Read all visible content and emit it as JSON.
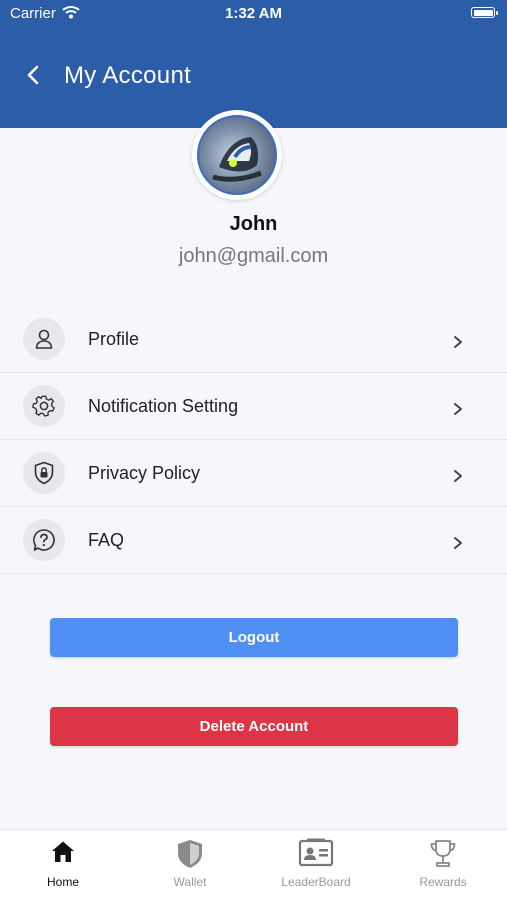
{
  "status_bar": {
    "carrier": "Carrier",
    "time": "1:32 AM"
  },
  "header": {
    "title": "My Account",
    "back_icon": "chevron-left-icon"
  },
  "user": {
    "name": "John",
    "email": "john@gmail.com"
  },
  "menu": [
    {
      "label": "Profile",
      "icon": "person-icon"
    },
    {
      "label": "Notification Setting",
      "icon": "gear-icon"
    },
    {
      "label": "Privacy Policy",
      "icon": "shield-lock-icon"
    },
    {
      "label": "FAQ",
      "icon": "question-bubble-icon"
    }
  ],
  "buttons": {
    "logout": "Logout",
    "delete_account": "Delete Account"
  },
  "tabs": [
    {
      "label": "Home",
      "icon": "home-icon",
      "active": true
    },
    {
      "label": "Wallet",
      "icon": "shield-icon",
      "active": false
    },
    {
      "label": "LeaderBoard",
      "icon": "id-card-icon",
      "active": false
    },
    {
      "label": "Rewards",
      "icon": "trophy-icon",
      "active": false
    }
  ],
  "colors": {
    "header": "#2b5da8",
    "logout": "#4f8ef2",
    "delete": "#dc3545",
    "background": "#f5f7fb"
  }
}
